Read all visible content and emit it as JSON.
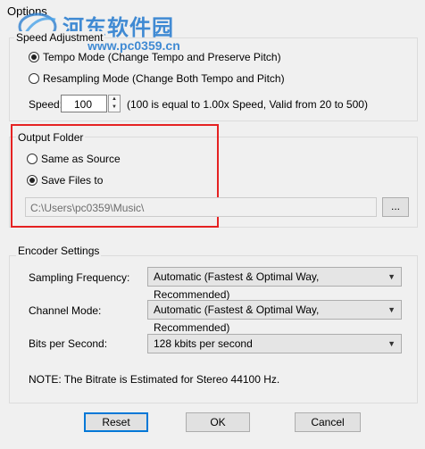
{
  "window": {
    "title": "Options"
  },
  "watermark": {
    "site_name": "河东软件园",
    "url": "www.pc0359.cn"
  },
  "speed": {
    "legend": "Speed Adjustment",
    "tempo_label": "Tempo Mode (Change Tempo and Preserve Pitch)",
    "resample_label": "Resampling Mode (Change Both Tempo and Pitch)",
    "selected_mode": "tempo",
    "speed_label": "Speed:",
    "speed_value": "100",
    "speed_note": "(100 is equal to 1.00x Speed, Valid from 20 to 500)"
  },
  "output": {
    "legend": "Output Folder",
    "same_label": "Same as Source",
    "save_label": "Save Files to",
    "selected": "save",
    "path": "C:\\Users\\pc0359\\Music\\",
    "browse_label": "..."
  },
  "encoder": {
    "legend": "Encoder Settings",
    "sampling_label": "Sampling Frequency:",
    "sampling_value": "Automatic (Fastest & Optimal Way, Recommended)",
    "channel_label": "Channel Mode:",
    "channel_value": "Automatic (Fastest & Optimal Way, Recommended)",
    "bits_label": "Bits per Second:",
    "bits_value": "128 kbits per second",
    "note": "NOTE: The Bitrate is Estimated  for Stereo 44100 Hz."
  },
  "buttons": {
    "reset": "Reset",
    "ok": "OK",
    "cancel": "Cancel"
  },
  "colors": {
    "highlight": "#e52222",
    "default_button_border": "#0078d7",
    "watermark": "#2e7fd0"
  }
}
